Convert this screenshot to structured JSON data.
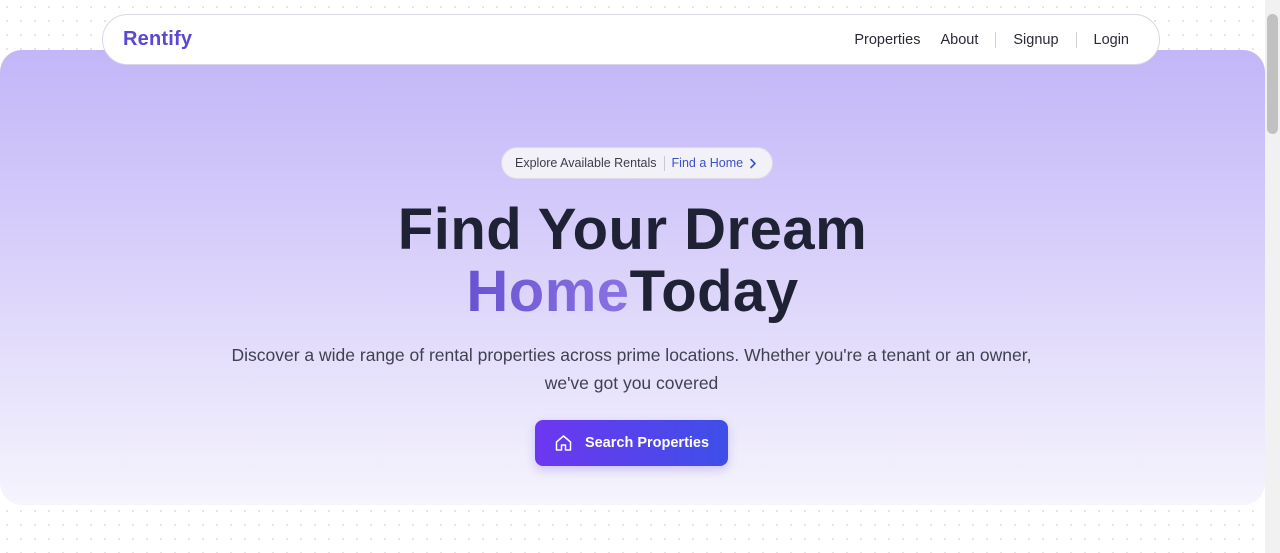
{
  "nav": {
    "brand": "Rentify",
    "links": [
      "Properties",
      "About",
      "Signup",
      "Login"
    ]
  },
  "hero": {
    "pill": {
      "text": "Explore Available Rentals",
      "link_label": "Find a Home"
    },
    "headline": {
      "line1": "Find Your Dream",
      "accent": "Home",
      "rest": "Today"
    },
    "description": "Discover a wide range of rental properties across prime locations. Whether you're a tenant or an owner, we've got you covered",
    "cta_label": "Search Properties"
  },
  "icons": {
    "pill_link": "chevron-right-icon",
    "cta": "home-icon"
  },
  "colors": {
    "brand": "#5b47d6",
    "headline": "#1f2235",
    "accent": "#7a63dc",
    "cta_start": "#6d37f0",
    "cta_end": "#3e4fe8",
    "hero_top": "#c3b6f8"
  }
}
